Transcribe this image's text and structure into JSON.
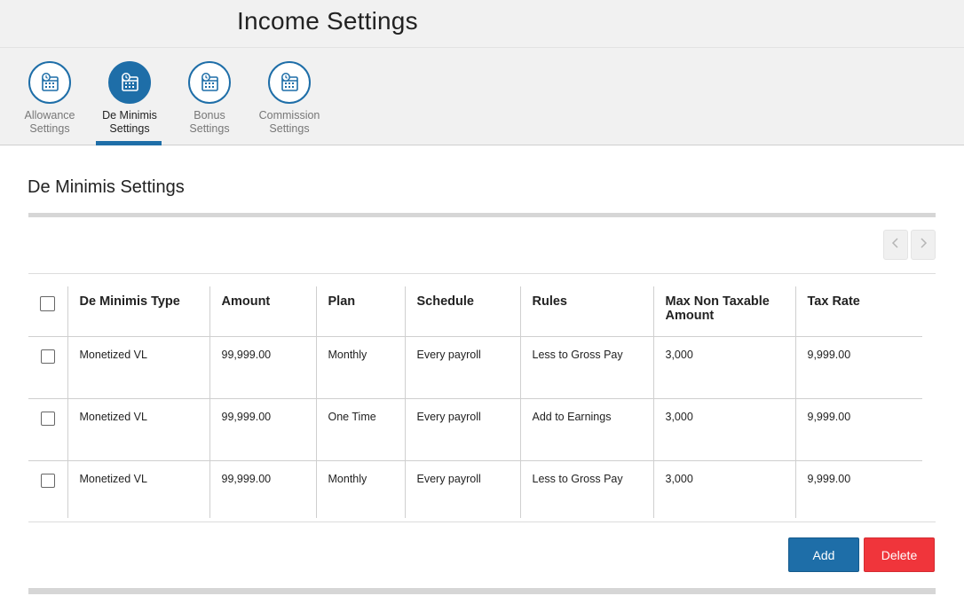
{
  "page": {
    "title": "Income Settings"
  },
  "tabs": [
    {
      "label": "Allowance\nSettings",
      "icon": "calendar-clock-icon",
      "active": false
    },
    {
      "label": "De Minimis\nSettings",
      "icon": "calendar-clock-icon",
      "active": true
    },
    {
      "label": "Bonus\nSettings",
      "icon": "calendar-clock-icon",
      "active": false
    },
    {
      "label": "Commission\nSettings",
      "icon": "calendar-clock-icon",
      "active": false
    }
  ],
  "section": {
    "title": "De Minimis Settings"
  },
  "pager": {
    "prev_icon": "chevron-left-icon",
    "next_icon": "chevron-right-icon"
  },
  "table": {
    "columns": [
      "De Minimis Type",
      "Amount",
      "Plan",
      "Schedule",
      "Rules",
      "Max Non Taxable Amount",
      "Tax Rate"
    ],
    "rows": [
      {
        "type": "Monetized VL",
        "amount": "99,999.00",
        "plan": "Monthly",
        "schedule": "Every payroll",
        "rules": "Less to Gross Pay",
        "max_non_taxable": "3,000",
        "tax_rate": "9,999.00"
      },
      {
        "type": "Monetized VL",
        "amount": "99,999.00",
        "plan": "One Time",
        "schedule": "Every payroll",
        "rules": "Add to Earnings",
        "max_non_taxable": "3,000",
        "tax_rate": "9,999.00"
      },
      {
        "type": "Monetized VL",
        "amount": "99,999.00",
        "plan": "Monthly",
        "schedule": "Every payroll",
        "rules": "Less to Gross Pay",
        "max_non_taxable": "3,000",
        "tax_rate": "9,999.00"
      }
    ]
  },
  "actions": {
    "add_label": "Add",
    "delete_label": "Delete"
  },
  "colors": {
    "primary": "#1e6ea8",
    "danger": "#f0353b",
    "header_bg": "#f1f1f1"
  }
}
